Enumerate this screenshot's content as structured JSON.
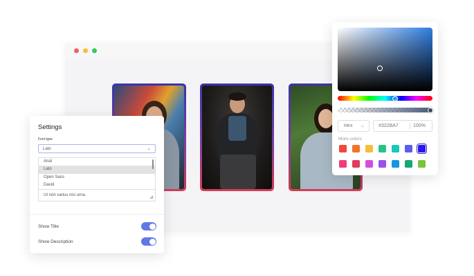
{
  "settings": {
    "title": "Settings",
    "font_type_label": "Font type",
    "font_selected": "Lato",
    "font_options": [
      "Arial",
      "Lato",
      "Open Sans",
      "David"
    ],
    "textarea_text": "Ut non varius nisi urna.",
    "show_title_label": "Show Title",
    "show_title_on": true,
    "show_description_label": "Show Description",
    "show_description_on": true
  },
  "color_picker": {
    "format": "Hex",
    "hex_value": "#322BA7",
    "opacity": "100%",
    "more_colors_label": "More colors",
    "swatches_row1": [
      "#f0473f",
      "#f2722a",
      "#f6be3b",
      "#27c486",
      "#19c7b7",
      "#5a5ee8",
      "#2a14f5"
    ],
    "swatches_row2": [
      "#ef3c7a",
      "#e23b5d",
      "#d44fd9",
      "#9c4fe9",
      "#1596e2",
      "#17a872",
      "#7ac43a"
    ]
  },
  "colors": {
    "accent": "#6277e6",
    "card_gradient_top": "#3a35a8",
    "card_gradient_bottom": "#d63b56"
  }
}
